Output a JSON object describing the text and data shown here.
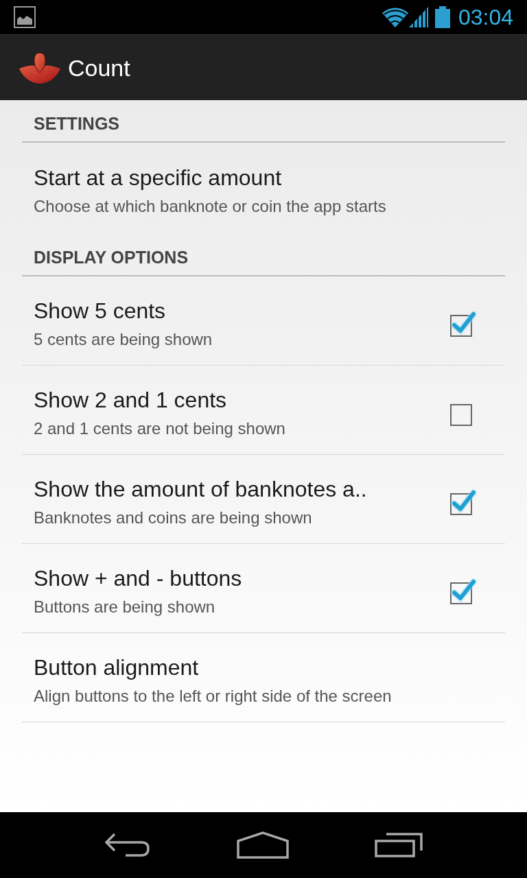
{
  "status_bar": {
    "time": "03:04"
  },
  "action_bar": {
    "title": "Count"
  },
  "sections": [
    {
      "header": "SETTINGS",
      "items": [
        {
          "kind": "plain",
          "title": "Start at a specific amount",
          "summary": "Choose at which banknote or coin the app starts"
        }
      ]
    },
    {
      "header": "DISPLAY OPTIONS",
      "items": [
        {
          "kind": "checkbox",
          "title": "Show 5 cents",
          "summary": "5 cents are being shown",
          "checked": true
        },
        {
          "kind": "checkbox",
          "title": "Show 2 and 1 cents",
          "summary": "2 and 1 cents are not being shown",
          "checked": false
        },
        {
          "kind": "checkbox",
          "title": "Show the amount of banknotes a..",
          "summary": "Banknotes and coins are being shown",
          "checked": true
        },
        {
          "kind": "checkbox",
          "title": "Show + and - buttons",
          "summary": "Buttons are being shown",
          "checked": true
        },
        {
          "kind": "plain",
          "title": "Button alignment",
          "summary": "Align buttons to the left or right side of the screen"
        }
      ]
    }
  ]
}
